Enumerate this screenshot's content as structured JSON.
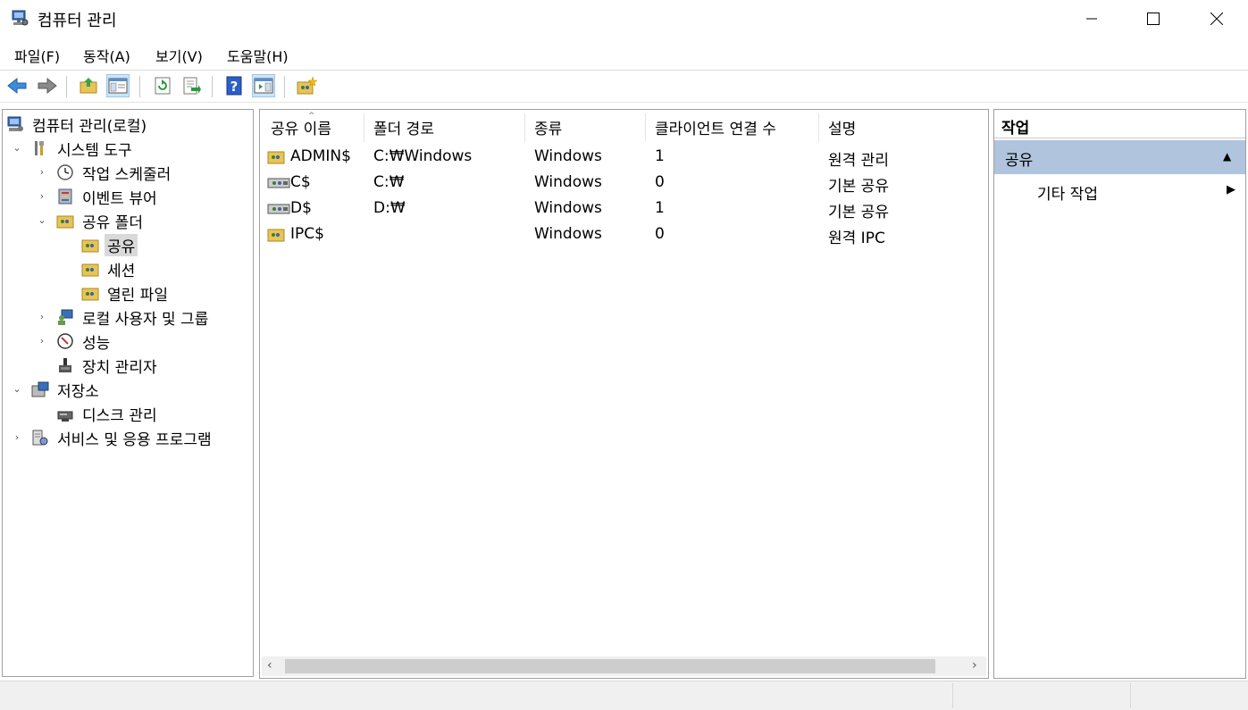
{
  "window": {
    "title": "컴퓨터 관리"
  },
  "menu": [
    "파일(F)",
    "동작(A)",
    "보기(V)",
    "도움말(H)"
  ],
  "toolbar": {
    "buttons": [
      "back-icon",
      "forward-icon",
      "up-folder-icon",
      "show-hide-tree-icon",
      "refresh-icon",
      "export-list-icon",
      "help-icon",
      "show-hide-action-pane-icon",
      "new-share-icon"
    ]
  },
  "tree": {
    "root": "컴퓨터 관리(로컬)",
    "system_tools": "시스템 도구",
    "task_scheduler": "작업 스케줄러",
    "event_viewer": "이벤트 뷰어",
    "shared_folders": "공유 폴더",
    "shares": "공유",
    "sessions": "세션",
    "open_files": "열린 파일",
    "local_users": "로컬 사용자 및 그룹",
    "performance": "성능",
    "device_manager": "장치 관리자",
    "storage": "저장소",
    "disk_management": "디스크 관리",
    "services_apps": "서비스 및 응용 프로그램"
  },
  "list": {
    "columns": [
      "공유 이름",
      "폴더 경로",
      "종류",
      "클라이언트 연결 수",
      "설명"
    ],
    "rows": [
      {
        "name": "ADMIN$",
        "path": "C:₩Windows",
        "type": "Windows",
        "clients": "1",
        "desc": "원격 관리"
      },
      {
        "name": "C$",
        "path": "C:₩",
        "type": "Windows",
        "clients": "0",
        "desc": "기본 공유"
      },
      {
        "name": "D$",
        "path": "D:₩",
        "type": "Windows",
        "clients": "1",
        "desc": "기본 공유"
      },
      {
        "name": "IPC$",
        "path": "",
        "type": "Windows",
        "clients": "0",
        "desc": "원격 IPC"
      }
    ]
  },
  "actions": {
    "header": "작업",
    "section": "공유",
    "more": "기타 작업"
  }
}
